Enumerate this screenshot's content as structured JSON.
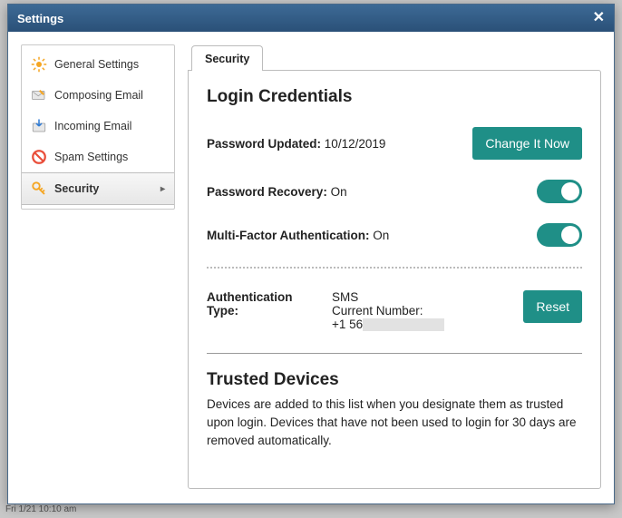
{
  "bg": {
    "line1": "",
    "line2": "Fri 1/21 10:10 am"
  },
  "dialog": {
    "title": "Settings"
  },
  "sidebar": [
    {
      "label": "General Settings",
      "icon": "gear",
      "active": false
    },
    {
      "label": "Composing Email",
      "icon": "compose",
      "active": false
    },
    {
      "label": "Incoming Email",
      "icon": "inbox",
      "active": false
    },
    {
      "label": "Spam Settings",
      "icon": "spam",
      "active": false
    },
    {
      "label": "Security",
      "icon": "key",
      "active": true
    }
  ],
  "tab": {
    "label": "Security"
  },
  "login_credentials": {
    "heading": "Login Credentials",
    "password_updated_label": "Password Updated:",
    "password_updated_value": "10/12/2019",
    "change_btn": "Change It Now",
    "password_recovery_label": "Password Recovery:",
    "password_recovery_value": "On",
    "mfa_label": "Multi-Factor Authentication:",
    "mfa_value": "On",
    "auth_type_label": "Authentication Type:",
    "auth_type_value": "SMS",
    "current_number_label": "Current Number:",
    "current_number_value": "+1 56",
    "reset_btn": "Reset"
  },
  "trusted": {
    "heading": "Trusted Devices",
    "desc": "Devices are added to this list when you designate them as trusted upon login. Devices that have not been used to login for 30 days are removed automatically."
  }
}
